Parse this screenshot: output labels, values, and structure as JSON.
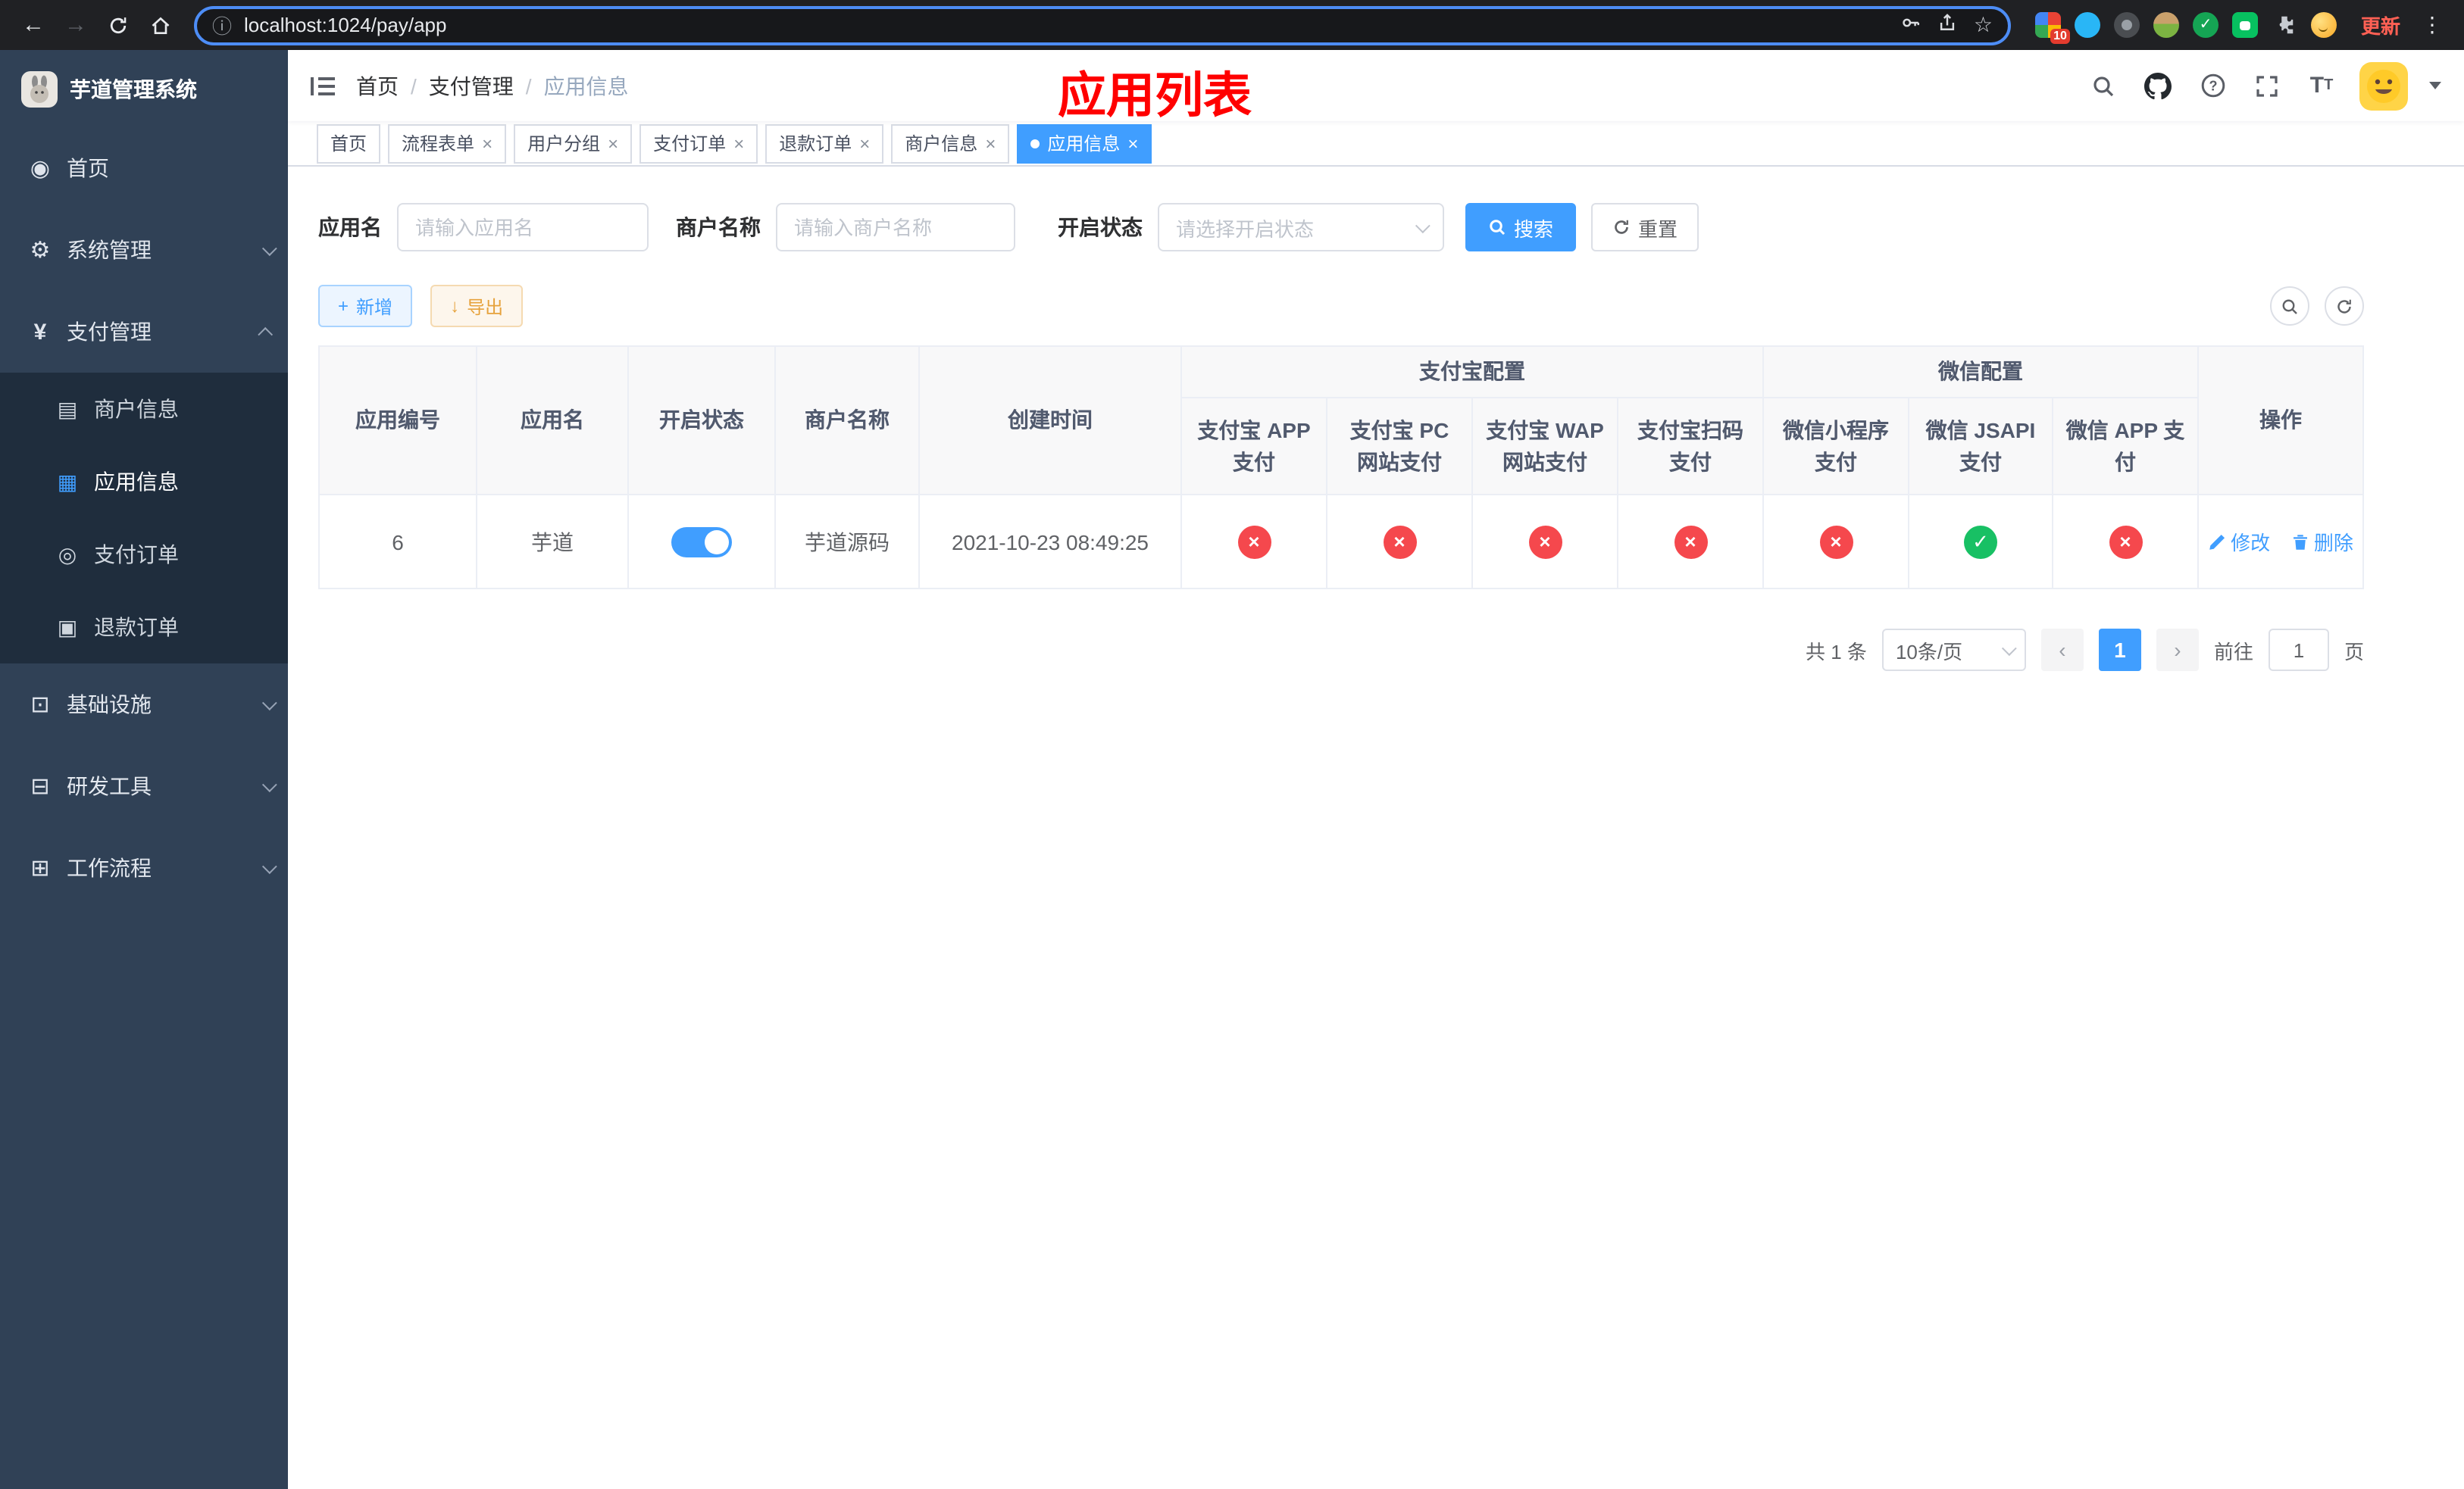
{
  "browser": {
    "url": "localhost:1024/pay/app",
    "update_label": "更新",
    "extensions_badge": "10"
  },
  "icons": {
    "back": "←",
    "forward": "→",
    "info": "ⓘ",
    "star": "☆",
    "kebab": "⋮",
    "dashboard": "◉",
    "gear": "⚙",
    "yen": "¥",
    "infra": "⊡",
    "tools": "⊟",
    "workflow": "⊞",
    "merchant": "▤",
    "app": "▦",
    "pay_order": "◎",
    "refund": "▣",
    "plus": "+",
    "download": "↓",
    "prev": "‹",
    "next": "›",
    "close": "×"
  },
  "sidebar": {
    "title": "芋道管理系统",
    "items": [
      {
        "label": "首页"
      },
      {
        "label": "系统管理"
      },
      {
        "label": "支付管理"
      },
      {
        "label": "基础设施"
      },
      {
        "label": "研发工具"
      },
      {
        "label": "工作流程"
      }
    ],
    "payment_children": [
      {
        "label": "商户信息"
      },
      {
        "label": "应用信息",
        "active": true
      },
      {
        "label": "支付订单"
      },
      {
        "label": "退款订单"
      }
    ]
  },
  "header": {
    "breadcrumb": [
      {
        "label": "首页"
      },
      {
        "label": "支付管理"
      },
      {
        "label": "应用信息"
      }
    ],
    "annotation": "应用列表"
  },
  "tabs": [
    {
      "label": "首页"
    },
    {
      "label": "流程表单"
    },
    {
      "label": "用户分组"
    },
    {
      "label": "支付订单"
    },
    {
      "label": "退款订单"
    },
    {
      "label": "商户信息"
    },
    {
      "label": "应用信息",
      "active": true
    }
  ],
  "filters": {
    "app_name": {
      "label": "应用名",
      "placeholder": "请输入应用名"
    },
    "merchant_name": {
      "label": "商户名称",
      "placeholder": "请输入商户名称"
    },
    "status": {
      "label": "开启状态",
      "placeholder": "请选择开启状态"
    },
    "search_label": "搜索",
    "reset_label": "重置"
  },
  "toolbar": {
    "add_label": "新增",
    "export_label": "导出"
  },
  "table": {
    "groups": {
      "alipay": "支付宝配置",
      "wechat": "微信配置"
    },
    "columns": {
      "app_id": "应用编号",
      "app_name": "应用名",
      "status": "开启状态",
      "merchant": "商户名称",
      "created": "创建时间",
      "alipay_app": "支付宝 APP 支付",
      "alipay_pc": "支付宝 PC 网站支付",
      "alipay_wap": "支付宝 WAP 网站支付",
      "alipay_qr": "支付宝扫码支付",
      "wx_lite": "微信小程序支付",
      "wx_jsapi": "微信 JSAPI 支付",
      "wx_app": "微信 APP 支付",
      "actions": "操作"
    },
    "rows": [
      {
        "app_id": "6",
        "app_name": "芋道",
        "enabled": true,
        "merchant": "芋道源码",
        "created": "2021-10-23 08:49:25",
        "alipay_app": "no",
        "alipay_pc": "no",
        "alipay_wap": "no",
        "alipay_qr": "no",
        "wx_lite": "no",
        "wx_jsapi": "yes",
        "wx_app": "no",
        "edit_label": "修改",
        "delete_label": "删除"
      }
    ]
  },
  "pagination": {
    "total_text": "共 1 条",
    "page_size_text": "10条/页",
    "current_page": "1",
    "goto_label": "前往",
    "goto_value": "1",
    "goto_suffix": "页"
  },
  "colors": {
    "primary": "#409eff",
    "success": "#18c064",
    "danger": "#f5484d",
    "warning": "#e6a23c",
    "annotation": "#ff0000",
    "sidebar_bg": "#304156",
    "submenu_bg": "#1f2d3d"
  }
}
